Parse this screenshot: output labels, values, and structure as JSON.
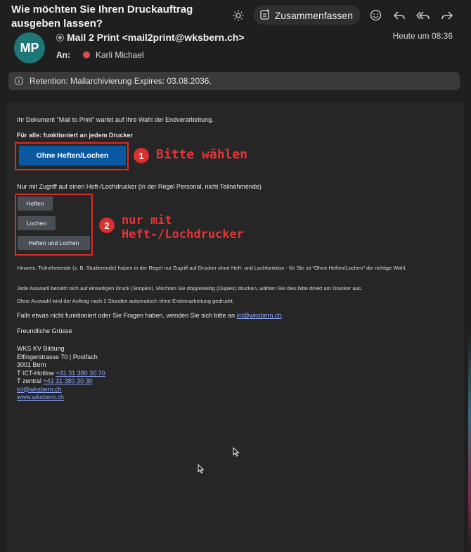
{
  "header": {
    "subject": "Wie möchten Sie Ihren Druckauftrag ausgeben lassen?",
    "summarize_label": "Zusammenfassen",
    "icons": [
      "sun-icon",
      "summarize-icon",
      "emoji-icon",
      "reply-icon",
      "reply-all-icon",
      "forward-icon"
    ]
  },
  "message": {
    "avatar_initials": "MP",
    "sender": "Mail 2 Print <mail2print@wksbern.ch>",
    "timestamp": "Heute um 08:36",
    "to_label": "An:",
    "recipient": "Karli Michael",
    "retention": "Retention: Mailarchivierung Expires: 03.08.2036."
  },
  "body": {
    "intro": "Ihr Dokument \"Mail to Print\" wartet auf Ihre Wahl der Endverarbeitung.",
    "all_heading": "Für alle: funktioniert an jedem Drucker",
    "primary_button": "Ohne Heften/Lochen",
    "restricted_heading": "Nur mit Zugriff auf einen Heft-/Lochdrucker (in der Regel Personal, nicht Teilnehmende)",
    "options": [
      "Heften",
      "Lochen",
      "Heften und Lochen"
    ],
    "hint": "Hinweis: Teilnehmende (z. B. Studierende) haben in der Regel nur Zugriff auf Drucker ohne Heft- und Lochfunktion - für Sie ist \"Ohne Heften/Lochen\" die richtige Wahl.",
    "simplex_note": "Jede Auswahl bezieht sich auf einseitigen Druck (Simplex). Möchten Sie doppelseitig (Duplex) drucken, wählen Sie dies bitte direkt am Drucker aus.",
    "timeout_note": "Ohne Auswahl wird der Auftrag nach 2 Stunden automatisch ohne Endverarbeitung gedruckt.",
    "contact_text": "Falls etwas nicht funktioniert oder Sie Fragen haben, wenden Sie sich bitte an",
    "contact_email": "ict@wksbern.ch",
    "contact_end": ".",
    "greeting": "Freundliche Grüsse",
    "signature": {
      "org": "WKS KV Bildung",
      "street": "Effingerstrasse 70 | Postfach",
      "city": "3001 Bern",
      "hotline_label": "T ICT-Hotline",
      "hotline": "+41 31 380 30 70",
      "central_label": "T zentral",
      "central": "+41 31 380 30 30",
      "email": "ict@wksbern.ch",
      "web": "www.wksbern.ch"
    }
  },
  "annotations": {
    "step1_number": "1",
    "step1_text": "Bitte wählen",
    "step2_number": "2",
    "step2_line1": "nur mit",
    "step2_line2": "Heft-/Lochdrucker"
  },
  "colors": {
    "background": "#1f1f1f",
    "primary_button": "#0a58a0",
    "annotation_red": "#d92b2b",
    "avatar": "#1d7776",
    "link": "#8fa8ff"
  }
}
